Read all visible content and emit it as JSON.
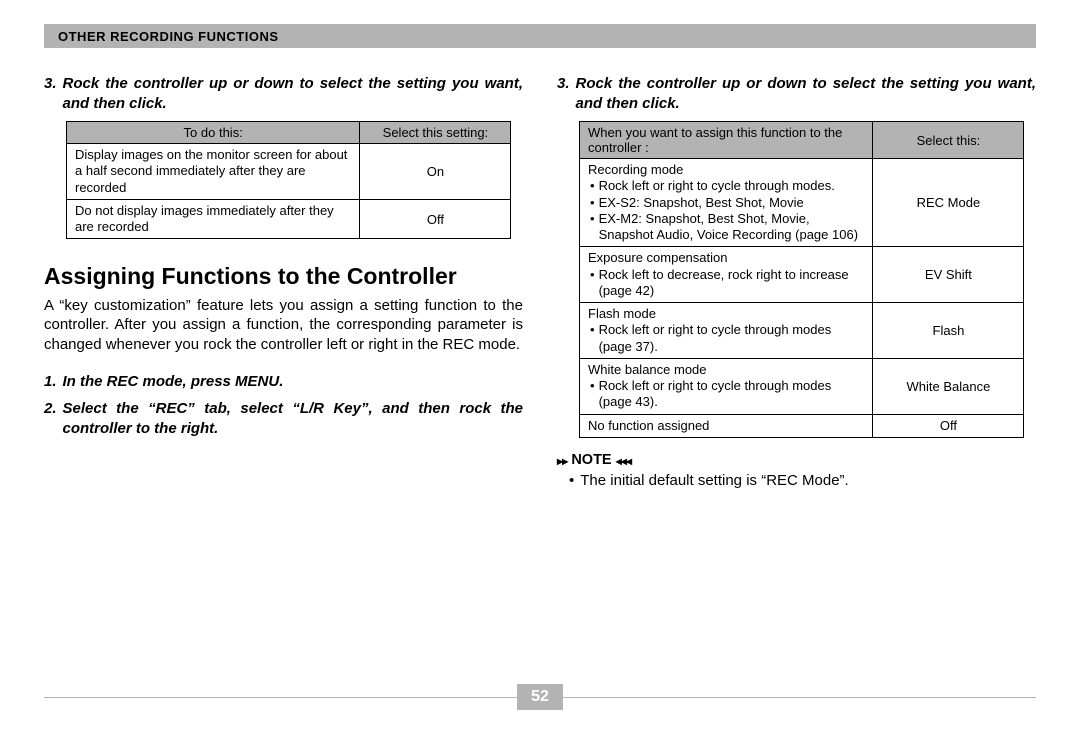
{
  "header": {
    "title": "OTHER RECORDING FUNCTIONS"
  },
  "left": {
    "step3_txt": "Rock the controller up or down to select the setting you want, and then click.",
    "table1": {
      "h1": "To do this:",
      "h2": "Select this setting:",
      "rows": [
        {
          "desc": "Display images on the monitor screen for about a half second immediately after they are recorded",
          "val": "On"
        },
        {
          "desc": "Do not display images immediately after they are recorded",
          "val": "Off"
        }
      ]
    },
    "section_title": "Assigning Functions to the Controller",
    "section_para": "A “key customization” feature lets you assign a setting function to the controller. After you assign a function, the corresponding parameter is changed whenever you rock the controller left or right in the REC mode.",
    "step1_txt": "In the REC mode, press MENU.",
    "step2_txt": "Select the “REC” tab, select “L/R Key”, and then rock the controller to the right."
  },
  "right": {
    "step3_txt": "Rock the controller up or down to select the setting you want, and then click.",
    "table2": {
      "h1": "When you want to assign this function to the controller :",
      "h2": "Select this:",
      "rows": [
        {
          "head": "Recording mode",
          "bullets": [
            "Rock left or right to cycle through modes.",
            "EX-S2: Snapshot, Best Shot, Movie",
            "EX-M2: Snapshot, Best Shot, Movie, Snapshot Audio, Voice Recording (page 106)"
          ],
          "val": "REC Mode"
        },
        {
          "head": "Exposure compensation",
          "bullets": [
            "Rock left to decrease, rock right to increase (page 42)"
          ],
          "val": "EV Shift"
        },
        {
          "head": "Flash mode",
          "bullets": [
            "Rock left or right to cycle through modes (page 37)."
          ],
          "val": "Flash"
        },
        {
          "head": "White balance mode",
          "bullets": [
            "Rock left or right to cycle through modes (page 43)."
          ],
          "val": "White Balance"
        },
        {
          "head": "No function assigned",
          "bullets": [],
          "val": "Off"
        }
      ]
    },
    "note_label": "NOTE",
    "note_bullet": "The initial default setting is “REC Mode”."
  },
  "page_number": "52"
}
